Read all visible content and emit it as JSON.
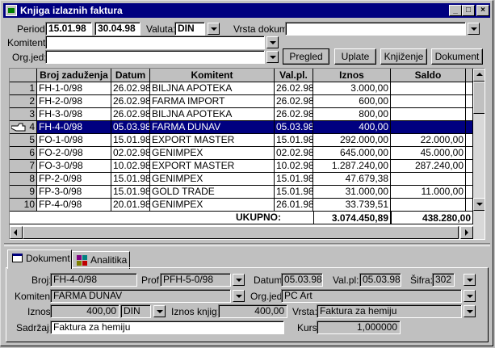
{
  "window": {
    "title": "Knjiga izlaznih faktura"
  },
  "filters": {
    "period_label": "Period:",
    "period_from": "15.01.98",
    "period_to": "30.04.98",
    "valuta_label": "Valuta:",
    "valuta_value": "DIN",
    "vrsta_label": "Vrsta dokum:",
    "vrsta_value": "",
    "komitent_label": "Komitent:",
    "komitent_value": "",
    "orgjed_label": "Org.jed:",
    "orgjed_value": ""
  },
  "toolbar": {
    "pregled": "Pregled",
    "uplate": "Uplate",
    "knjizenje": "Knjiženje",
    "dokument": "Dokument"
  },
  "table": {
    "headers": [
      "Broj zaduženja",
      "Datum",
      "Komitent",
      "Val.pl.",
      "Iznos",
      "Saldo"
    ],
    "rows": [
      [
        "1",
        "FH-1-0/98",
        "26.02.98",
        "BILJNA APOTEKA",
        "26.02.98",
        "3.000,00",
        ""
      ],
      [
        "2",
        "FH-2-0/98",
        "26.02.98",
        "FARMA IMPORT",
        "26.02.98",
        "600,00",
        ""
      ],
      [
        "3",
        "FH-3-0/98",
        "26.02.98",
        "BILJNA APOTEKA",
        "26.02.98",
        "800,00",
        ""
      ],
      [
        "4",
        "FH-4-0/98",
        "05.03.98",
        "FARMA DUNAV",
        "05.03.98",
        "400,00",
        ""
      ],
      [
        "5",
        "FO-1-0/98",
        "15.01.98",
        "EXPORT MASTER",
        "15.01.98",
        "292.000,00",
        "22.000,00"
      ],
      [
        "6",
        "FO-2-0/98",
        "02.02.98",
        "GENIMPEX",
        "02.02.98",
        "645.000,00",
        "45.000,00"
      ],
      [
        "7",
        "FO-3-0/98",
        "10.02.98",
        "EXPORT MASTER",
        "10.02.98",
        "1.287.240,00",
        "287.240,00"
      ],
      [
        "8",
        "FP-2-0/98",
        "15.01.98",
        "GENIMPEX",
        "15.01.98",
        "47.679,38",
        ""
      ],
      [
        "9",
        "FP-3-0/98",
        "15.01.98",
        "GOLD TRADE",
        "15.01.98",
        "31.000,00",
        "11.000,00"
      ],
      [
        "10",
        "FP-4-0/98",
        "20.01.98",
        "GENIMPEX",
        "26.01.98",
        "33.739,51",
        ""
      ]
    ],
    "selected_row": 3,
    "total_label": "UKUPNO:",
    "total_iznos": "3.074.450,89",
    "total_saldo": "438.280,00"
  },
  "tabs": {
    "dokument": "Dokument",
    "analitika": "Analitika"
  },
  "detail": {
    "broj_label": "Broj:",
    "broj": "FH-4-0/98",
    "prof_label": "Prof:",
    "prof": "PFH-5-0/98",
    "datum_label": "Datum:",
    "datum": "05.03.98",
    "valpl_label": "Val.pl:",
    "valpl": "05.03.98",
    "sifra_label": "Šifra:",
    "sifra": "302",
    "komitent_label": "Komitent:",
    "komitent": "FARMA DUNAV",
    "orgjed_label": "Org.jed:",
    "orgjed": "PC Art",
    "iznos_label": "Iznos:",
    "iznos": "400,00",
    "valuta": "DIN",
    "iznosknj_label": "Iznos knjig:",
    "iznosknj": "400,00",
    "vrsta_label": "Vrsta:",
    "vrsta": "Faktura za hemiju",
    "sadrzaj_label": "Sadržaj:",
    "sadrzaj": "Faktura za hemiju",
    "kurs_label": "Kurs:",
    "kurs": "1,000000"
  }
}
